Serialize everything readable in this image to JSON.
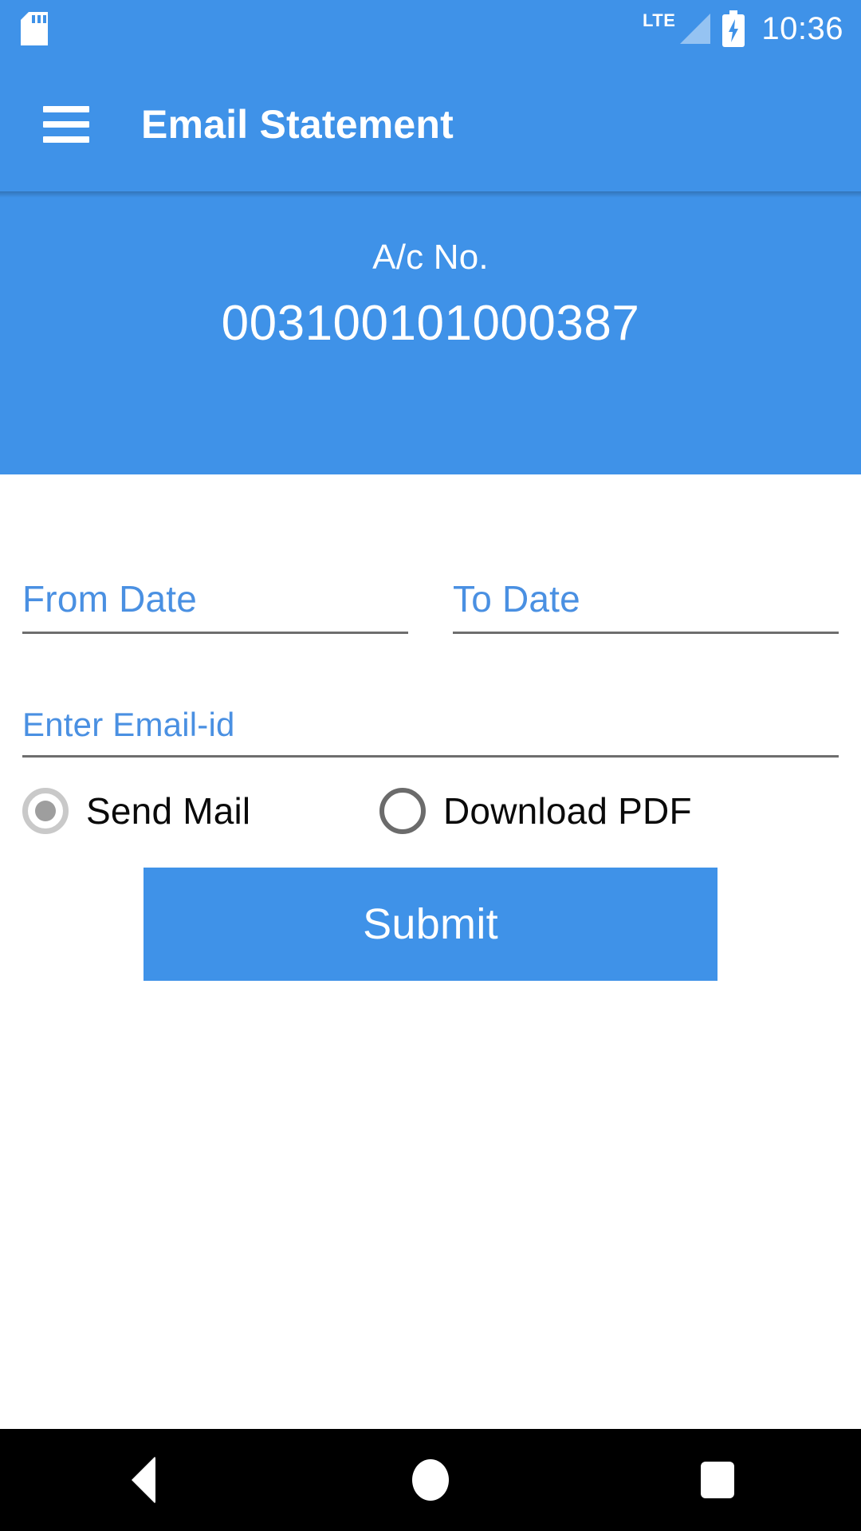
{
  "status_bar": {
    "sd_card_icon": "sd-card-icon",
    "network_label": "LTE",
    "signal_icon": "signal-triangle-icon",
    "battery_icon": "battery-charging-icon",
    "time": "10:36"
  },
  "toolbar": {
    "menu_icon": "hamburger-menu-icon",
    "title": "Email Statement"
  },
  "account_header": {
    "label": "A/c No.",
    "number": "003100101000387"
  },
  "form": {
    "from_date": {
      "placeholder": "From Date",
      "value": ""
    },
    "to_date": {
      "placeholder": "To Date",
      "value": ""
    },
    "email": {
      "placeholder": "Enter Email-id",
      "value": ""
    },
    "delivery_options": [
      {
        "label": "Send Mail",
        "selected": true
      },
      {
        "label": "Download PDF",
        "selected": false
      }
    ],
    "submit_label": "Submit"
  },
  "nav_bar": {
    "back_icon": "back-triangle-icon",
    "home_icon": "home-circle-icon",
    "recents_icon": "recents-square-icon"
  },
  "colors": {
    "primary_blue": "#3F92E8",
    "placeholder_blue": "#4A90E2",
    "underline_gray": "#6E6E6E",
    "nav_black": "#000000"
  }
}
